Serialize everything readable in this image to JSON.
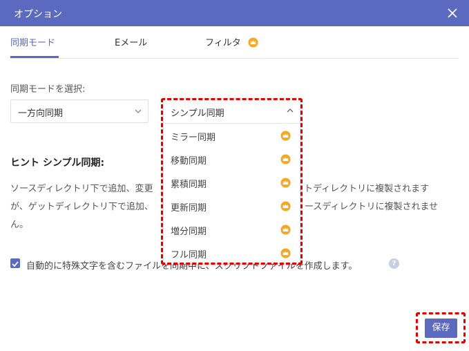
{
  "window": {
    "title": "オプション",
    "close_icon": "close-icon"
  },
  "tabs": [
    {
      "label": "同期モード",
      "active": true
    },
    {
      "label": "Eメール",
      "active": false
    },
    {
      "label": "フィルタ",
      "active": false,
      "premium_icon": "crown-icon"
    }
  ],
  "sync": {
    "label": "同期モードを選択:",
    "direction_value": "一方向同期",
    "mode_value": "シンプル同期",
    "options": [
      {
        "label": "ミラー同期",
        "premium_icon": "crown-icon"
      },
      {
        "label": "移動同期",
        "premium_icon": "crown-icon"
      },
      {
        "label": "累積同期",
        "premium_icon": "crown-icon"
      },
      {
        "label": "更新同期",
        "premium_icon": "crown-icon"
      },
      {
        "label": "増分同期",
        "premium_icon": "crown-icon"
      },
      {
        "label": "フル同期",
        "premium_icon": "crown-icon"
      }
    ]
  },
  "hint": {
    "title": "ヒント シンプル同期:",
    "line1_left": "ソースディレクトリ下で追加、変更",
    "line1_right": "ットディレクトリに複製されます",
    "line2_left": "が、ゲットディレクトリ下で追加、",
    "line2_right": "ースディレクトリに複製されませ",
    "line3": "ん。"
  },
  "options": {
    "checkbox_label": "自動的に特殊文字を含むファイルを同期中に、スクリプトファイルを作成します。",
    "checked": true,
    "help_icon": "help-icon"
  },
  "footer": {
    "save_label": "保存"
  },
  "colors": {
    "accent": "#5b6abe",
    "premium": "#f5a623",
    "highlight": "#e00000"
  }
}
